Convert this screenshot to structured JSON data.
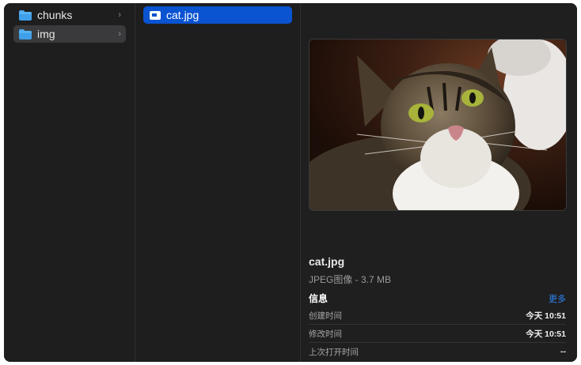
{
  "column1": {
    "items": [
      {
        "label": "chunks",
        "icon": "folder-icon"
      },
      {
        "label": "img",
        "icon": "folder-icon"
      }
    ]
  },
  "column2": {
    "items": [
      {
        "label": "cat.jpg",
        "icon": "image-file-icon"
      }
    ]
  },
  "preview": {
    "image_subject": "photo of a tabby cat with white chest",
    "filename": "cat.jpg",
    "type": "JPEG图像 - 3.7 MB",
    "info_title": "信息",
    "more_link": "更多",
    "info_rows": [
      {
        "key": "创建时间",
        "value": "今天 10:51"
      },
      {
        "key": "修改时间",
        "value": "今天 10:51"
      },
      {
        "key": "上次打开时间",
        "value": "--"
      }
    ]
  },
  "colors": {
    "selection": "#0a53d1",
    "accent_link": "#2f86f7",
    "folder": "#3f9fe9"
  }
}
